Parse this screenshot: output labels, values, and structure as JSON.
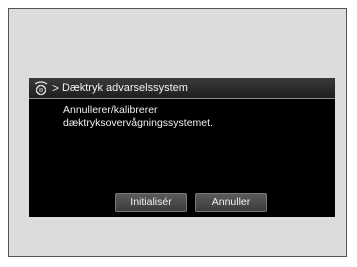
{
  "dialog": {
    "title": "Dæktryk advarselssystem",
    "title_icon": "tire-pressure-icon",
    "separator": ">",
    "message_line1": "Annullerer/kalibrerer",
    "message_line2": "dæktryksovervågningssystemet."
  },
  "buttons": {
    "initialize_label": "Initialisér",
    "cancel_label": "Annuller"
  },
  "colors": {
    "screen_background": "#000000",
    "text": "#f2f2f2",
    "frame_background": "#dcdcdc"
  }
}
